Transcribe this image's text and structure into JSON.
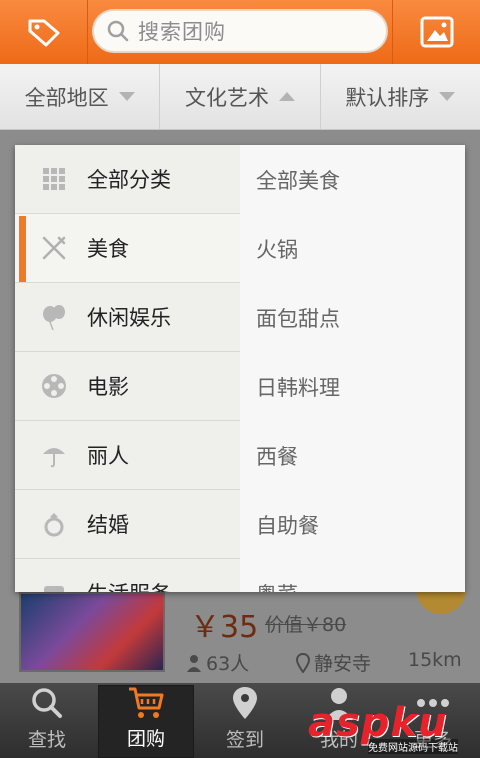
{
  "header": {
    "search_placeholder": "搜索团购"
  },
  "filters": [
    {
      "label": "全部地区",
      "arrow": "down"
    },
    {
      "label": "文化艺术",
      "arrow": "up"
    },
    {
      "label": "默认排序",
      "arrow": "down"
    }
  ],
  "categories": [
    {
      "label": "全部分类",
      "icon": "grid-icon"
    },
    {
      "label": "美食",
      "icon": "fork-knife-icon",
      "active": true
    },
    {
      "label": "休闲娱乐",
      "icon": "balloon-icon"
    },
    {
      "label": "电影",
      "icon": "film-reel-icon"
    },
    {
      "label": "丽人",
      "icon": "umbrella-icon"
    },
    {
      "label": "结婚",
      "icon": "ring-icon"
    },
    {
      "label": "生活服务",
      "icon": "service-icon"
    }
  ],
  "subcategories": [
    "全部美食",
    "火锅",
    "面包甜点",
    "日韩料理",
    "西餐",
    "自助餐",
    "粤菜"
  ],
  "deal": {
    "price": "￥35",
    "original_price": "价值￥80",
    "people": "63人",
    "location": "静安寺",
    "distance": "15km"
  },
  "tabs": [
    {
      "label": "查找",
      "icon": "search-icon"
    },
    {
      "label": "团购",
      "icon": "cart-icon",
      "active": true
    },
    {
      "label": "签到",
      "icon": "location-pin-icon"
    },
    {
      "label": "我的",
      "icon": "user-icon"
    },
    {
      "label": "更多",
      "icon": "more-icon"
    }
  ],
  "watermark": {
    "text": "aspku",
    "sub": "免费网站源码下载站"
  },
  "colors": {
    "accent": "#f07a22",
    "topbar": "#ee6a17"
  }
}
